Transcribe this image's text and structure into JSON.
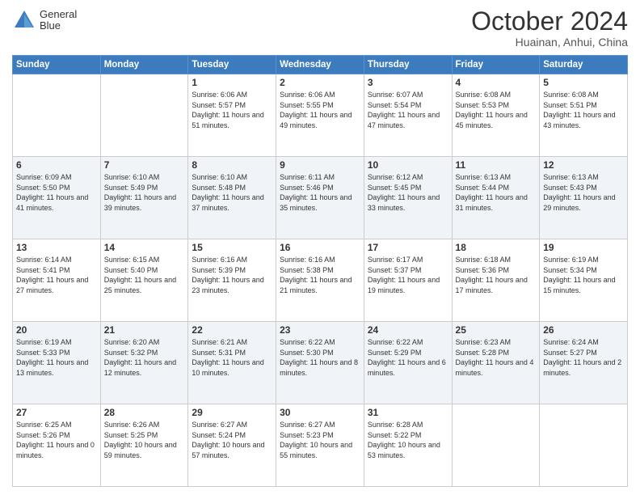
{
  "header": {
    "logo": {
      "line1": "General",
      "line2": "Blue"
    },
    "title": "October 2024",
    "location": "Huainan, Anhui, China"
  },
  "days_of_week": [
    "Sunday",
    "Monday",
    "Tuesday",
    "Wednesday",
    "Thursday",
    "Friday",
    "Saturday"
  ],
  "weeks": [
    [
      {
        "day": "",
        "sunrise": "",
        "sunset": "",
        "daylight": ""
      },
      {
        "day": "",
        "sunrise": "",
        "sunset": "",
        "daylight": ""
      },
      {
        "day": "1",
        "sunrise": "Sunrise: 6:06 AM",
        "sunset": "Sunset: 5:57 PM",
        "daylight": "Daylight: 11 hours and 51 minutes."
      },
      {
        "day": "2",
        "sunrise": "Sunrise: 6:06 AM",
        "sunset": "Sunset: 5:55 PM",
        "daylight": "Daylight: 11 hours and 49 minutes."
      },
      {
        "day": "3",
        "sunrise": "Sunrise: 6:07 AM",
        "sunset": "Sunset: 5:54 PM",
        "daylight": "Daylight: 11 hours and 47 minutes."
      },
      {
        "day": "4",
        "sunrise": "Sunrise: 6:08 AM",
        "sunset": "Sunset: 5:53 PM",
        "daylight": "Daylight: 11 hours and 45 minutes."
      },
      {
        "day": "5",
        "sunrise": "Sunrise: 6:08 AM",
        "sunset": "Sunset: 5:51 PM",
        "daylight": "Daylight: 11 hours and 43 minutes."
      }
    ],
    [
      {
        "day": "6",
        "sunrise": "Sunrise: 6:09 AM",
        "sunset": "Sunset: 5:50 PM",
        "daylight": "Daylight: 11 hours and 41 minutes."
      },
      {
        "day": "7",
        "sunrise": "Sunrise: 6:10 AM",
        "sunset": "Sunset: 5:49 PM",
        "daylight": "Daylight: 11 hours and 39 minutes."
      },
      {
        "day": "8",
        "sunrise": "Sunrise: 6:10 AM",
        "sunset": "Sunset: 5:48 PM",
        "daylight": "Daylight: 11 hours and 37 minutes."
      },
      {
        "day": "9",
        "sunrise": "Sunrise: 6:11 AM",
        "sunset": "Sunset: 5:46 PM",
        "daylight": "Daylight: 11 hours and 35 minutes."
      },
      {
        "day": "10",
        "sunrise": "Sunrise: 6:12 AM",
        "sunset": "Sunset: 5:45 PM",
        "daylight": "Daylight: 11 hours and 33 minutes."
      },
      {
        "day": "11",
        "sunrise": "Sunrise: 6:13 AM",
        "sunset": "Sunset: 5:44 PM",
        "daylight": "Daylight: 11 hours and 31 minutes."
      },
      {
        "day": "12",
        "sunrise": "Sunrise: 6:13 AM",
        "sunset": "Sunset: 5:43 PM",
        "daylight": "Daylight: 11 hours and 29 minutes."
      }
    ],
    [
      {
        "day": "13",
        "sunrise": "Sunrise: 6:14 AM",
        "sunset": "Sunset: 5:41 PM",
        "daylight": "Daylight: 11 hours and 27 minutes."
      },
      {
        "day": "14",
        "sunrise": "Sunrise: 6:15 AM",
        "sunset": "Sunset: 5:40 PM",
        "daylight": "Daylight: 11 hours and 25 minutes."
      },
      {
        "day": "15",
        "sunrise": "Sunrise: 6:16 AM",
        "sunset": "Sunset: 5:39 PM",
        "daylight": "Daylight: 11 hours and 23 minutes."
      },
      {
        "day": "16",
        "sunrise": "Sunrise: 6:16 AM",
        "sunset": "Sunset: 5:38 PM",
        "daylight": "Daylight: 11 hours and 21 minutes."
      },
      {
        "day": "17",
        "sunrise": "Sunrise: 6:17 AM",
        "sunset": "Sunset: 5:37 PM",
        "daylight": "Daylight: 11 hours and 19 minutes."
      },
      {
        "day": "18",
        "sunrise": "Sunrise: 6:18 AM",
        "sunset": "Sunset: 5:36 PM",
        "daylight": "Daylight: 11 hours and 17 minutes."
      },
      {
        "day": "19",
        "sunrise": "Sunrise: 6:19 AM",
        "sunset": "Sunset: 5:34 PM",
        "daylight": "Daylight: 11 hours and 15 minutes."
      }
    ],
    [
      {
        "day": "20",
        "sunrise": "Sunrise: 6:19 AM",
        "sunset": "Sunset: 5:33 PM",
        "daylight": "Daylight: 11 hours and 13 minutes."
      },
      {
        "day": "21",
        "sunrise": "Sunrise: 6:20 AM",
        "sunset": "Sunset: 5:32 PM",
        "daylight": "Daylight: 11 hours and 12 minutes."
      },
      {
        "day": "22",
        "sunrise": "Sunrise: 6:21 AM",
        "sunset": "Sunset: 5:31 PM",
        "daylight": "Daylight: 11 hours and 10 minutes."
      },
      {
        "day": "23",
        "sunrise": "Sunrise: 6:22 AM",
        "sunset": "Sunset: 5:30 PM",
        "daylight": "Daylight: 11 hours and 8 minutes."
      },
      {
        "day": "24",
        "sunrise": "Sunrise: 6:22 AM",
        "sunset": "Sunset: 5:29 PM",
        "daylight": "Daylight: 11 hours and 6 minutes."
      },
      {
        "day": "25",
        "sunrise": "Sunrise: 6:23 AM",
        "sunset": "Sunset: 5:28 PM",
        "daylight": "Daylight: 11 hours and 4 minutes."
      },
      {
        "day": "26",
        "sunrise": "Sunrise: 6:24 AM",
        "sunset": "Sunset: 5:27 PM",
        "daylight": "Daylight: 11 hours and 2 minutes."
      }
    ],
    [
      {
        "day": "27",
        "sunrise": "Sunrise: 6:25 AM",
        "sunset": "Sunset: 5:26 PM",
        "daylight": "Daylight: 11 hours and 0 minutes."
      },
      {
        "day": "28",
        "sunrise": "Sunrise: 6:26 AM",
        "sunset": "Sunset: 5:25 PM",
        "daylight": "Daylight: 10 hours and 59 minutes."
      },
      {
        "day": "29",
        "sunrise": "Sunrise: 6:27 AM",
        "sunset": "Sunset: 5:24 PM",
        "daylight": "Daylight: 10 hours and 57 minutes."
      },
      {
        "day": "30",
        "sunrise": "Sunrise: 6:27 AM",
        "sunset": "Sunset: 5:23 PM",
        "daylight": "Daylight: 10 hours and 55 minutes."
      },
      {
        "day": "31",
        "sunrise": "Sunrise: 6:28 AM",
        "sunset": "Sunset: 5:22 PM",
        "daylight": "Daylight: 10 hours and 53 minutes."
      },
      {
        "day": "",
        "sunrise": "",
        "sunset": "",
        "daylight": ""
      },
      {
        "day": "",
        "sunrise": "",
        "sunset": "",
        "daylight": ""
      }
    ]
  ]
}
